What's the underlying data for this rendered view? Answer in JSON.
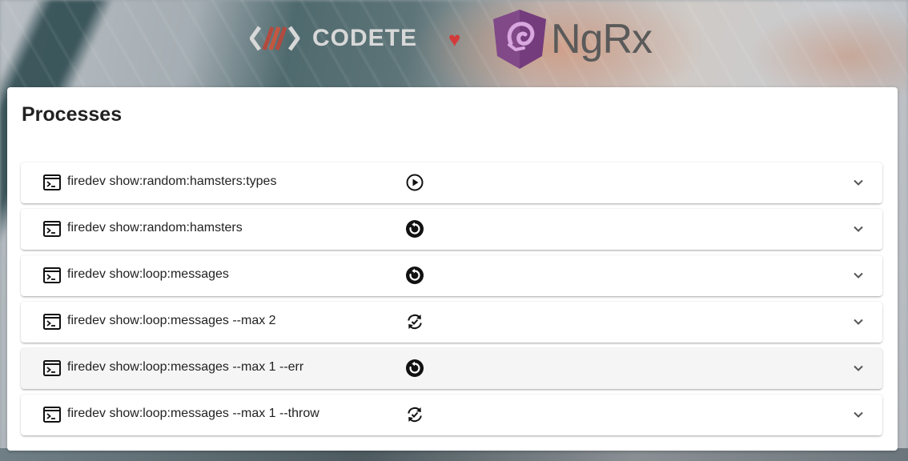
{
  "header": {
    "codete_text": "CODETE",
    "heart_glyph": "♥",
    "ngrx_text": "NgRx",
    "heart_color": "#d33b3b",
    "ngrx_shield_color": "#7b3f86"
  },
  "card": {
    "title": "Processes"
  },
  "processes": [
    {
      "label": "firedev show:random:hamsters:types",
      "status_icon": "play-circle-icon"
    },
    {
      "label": "firedev show:random:hamsters",
      "status_icon": "restart-icon"
    },
    {
      "label": "firedev show:loop:messages",
      "status_icon": "restart-icon"
    },
    {
      "label": "firedev show:loop:messages --max 2",
      "status_icon": "sync-check-icon"
    },
    {
      "label": "firedev show:loop:messages --max 1 --err",
      "status_icon": "restart-icon",
      "hovered": true
    },
    {
      "label": "firedev show:loop:messages --max 1 --throw",
      "status_icon": "sync-check-icon"
    }
  ]
}
